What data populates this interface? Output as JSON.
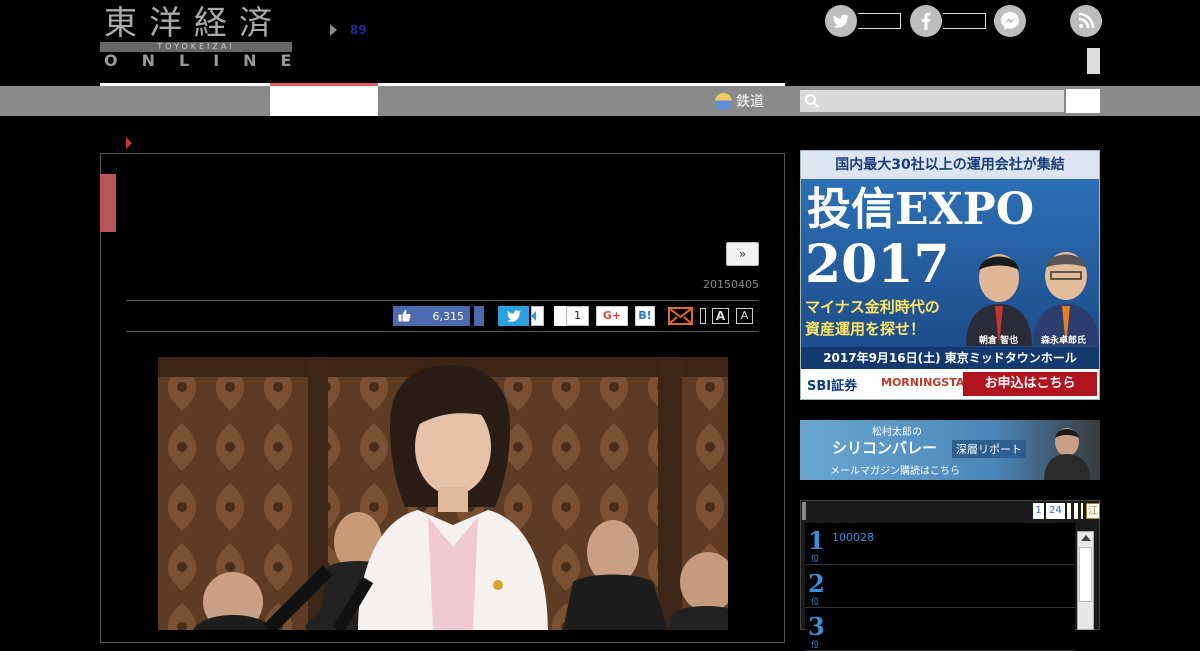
{
  "header": {
    "logo_jp": "東洋経済",
    "logo_romaji": "TOYOKEIZAI",
    "logo_en": "ONLINE",
    "top_count": "89",
    "social_icons": [
      "twitter-icon",
      "facebook-icon",
      "messenger-icon",
      "rss-icon"
    ]
  },
  "nav": {
    "rail_label": "鉄道"
  },
  "article": {
    "next_label": "»",
    "date": "20150405",
    "share": {
      "like_count": "6,315",
      "hatena_count": "1",
      "gplus_label": "G+",
      "hatena_label": "B!",
      "font_large": "A",
      "font_small": "A"
    }
  },
  "sidebar": {
    "expo_ad": {
      "top": "国内最大30社以上の運用会社が集結",
      "title": "投信EXPO",
      "year": "2017",
      "sub1": "マイナス金利時代の",
      "sub2": "資産運用を探せ！",
      "person1": "朝倉 智也",
      "person2": "森永卓郎氏",
      "date": "2017年9月16日(土) 東京ミッドタウンホール",
      "sponsor1": "SBI証券",
      "sponsor2": "MORNINGSTAR",
      "cta": "お申込はこちら"
    },
    "silicon_ad": {
      "author": "松村太郎の",
      "title": "シリコンバレー",
      "tag": "深層リポート",
      "cta": "メールマガジン購読はこちら"
    },
    "ranking": {
      "tabs": [
        "1",
        "24",
        "",
        "",
        "",
        "江"
      ],
      "items": [
        {
          "num": "1",
          "sub": "位",
          "text": "100028"
        },
        {
          "num": "2",
          "sub": "位",
          "text": ""
        },
        {
          "num": "3",
          "sub": "位",
          "text": ""
        }
      ]
    }
  }
}
